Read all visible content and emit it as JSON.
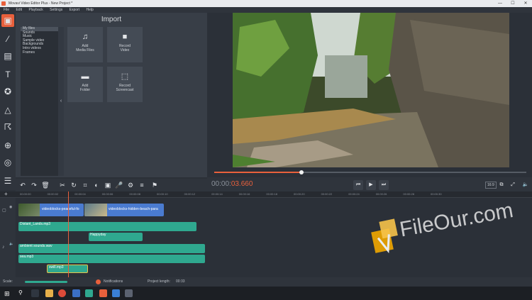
{
  "window": {
    "title": "Movavi Video Editor Plus - New Project *"
  },
  "menu": [
    "File",
    "Edit",
    "Playback",
    "Settings",
    "Export",
    "Help"
  ],
  "left_tools": [
    "import-icon",
    "magic-wand-icon",
    "filmstrip-icon",
    "text-icon",
    "star-icon",
    "shapes-icon",
    "running-man-icon",
    "zoom-icon",
    "webcam-icon",
    "menu-icon"
  ],
  "import": {
    "title": "Import",
    "categories": [
      "My files",
      "Sounds",
      "Music",
      "Sample video",
      "Backgrounds",
      "Intro videos",
      "Frames"
    ],
    "tiles": [
      {
        "line1": "Add",
        "line2": "Media Files",
        "icon": "media-files-icon"
      },
      {
        "line1": "Record",
        "line2": "Video",
        "icon": "camera-icon"
      },
      {
        "line1": "Add",
        "line2": "Folder",
        "icon": "folder-icon"
      },
      {
        "line1": "Record",
        "line2": "Screencast",
        "icon": "screencast-icon"
      }
    ]
  },
  "player": {
    "timecode_prefix": "00:00:",
    "timecode_active": "03.660",
    "progress": 0.28,
    "ratio": "16:9"
  },
  "ruler_ticks": [
    "00:00:00",
    "00:00:02",
    "00:00:04",
    "00:00:06",
    "00:00:08",
    "00:00:10",
    "00:00:12",
    "00:00:14",
    "00:00:16",
    "00:00:18",
    "00:00:20",
    "00:00:22",
    "00:00:24",
    "00:00:26",
    "00:00:28",
    "00:00:30"
  ],
  "clips": {
    "video1": "videoblocks-peaceful-fo",
    "video2": "videoblocks-hidden-beach-para",
    "audio1": "Distant_Lands.mp3",
    "audio2": "Happyday",
    "audio3": "ambient sounds.wav",
    "audio4": "sea.mp3",
    "audio5": "swill.mp3"
  },
  "status": {
    "scale_label": "Scale:",
    "notifications": "Notifications",
    "project_length_label": "Project length:",
    "project_length": "00:33"
  },
  "watermark": {
    "text": "FileOur.com"
  },
  "colors": {
    "accent": "#e8603c",
    "video_clip": "#4a7bd0",
    "audio_clip": "#2fa88f"
  }
}
